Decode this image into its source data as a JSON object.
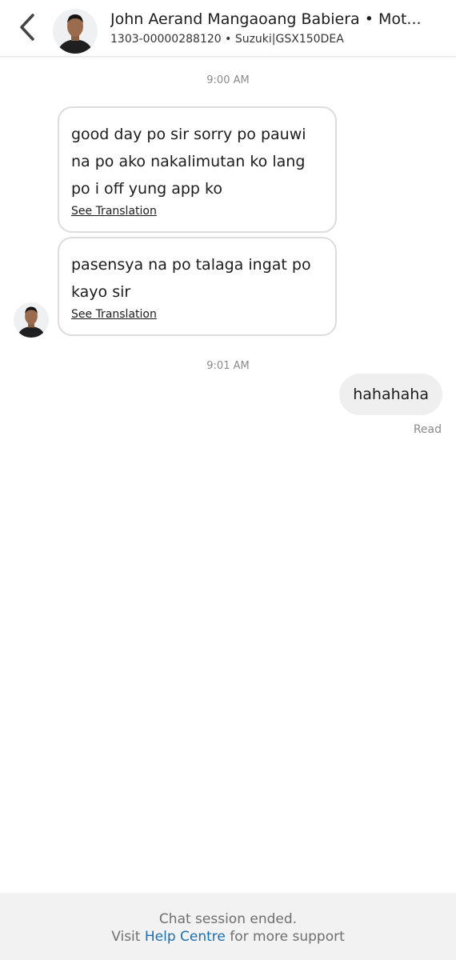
{
  "header": {
    "title": "John Aerand Mangaoang Babiera • Mot...",
    "subtitle": "1303-00000288120 • Suzuki|GSX150DEA"
  },
  "messages": {
    "time_1": "9:00 AM",
    "in_1": "good day po sir sorry po pauwi na po ako nakalimutan ko lang po i off yung app ko",
    "in_1_translate": "See Translation",
    "in_2": "pasensya na po talaga ingat po kayo sir",
    "in_2_translate": "See Translation",
    "time_2": "9:01 AM",
    "out_1": "hahahaha",
    "out_1_status": "Read"
  },
  "footer": {
    "line1": "Chat session ended.",
    "line2_prefix": "Visit",
    "line2_link": "Help Centre",
    "line2_suffix": "for more support"
  },
  "colors": {
    "link": "#1a6fb5",
    "bubble_border": "#dcdcdc",
    "outgoing_bubble": "#efefef",
    "footer_bg": "#f2f2f2",
    "muted_text": "#8a8a8a"
  }
}
